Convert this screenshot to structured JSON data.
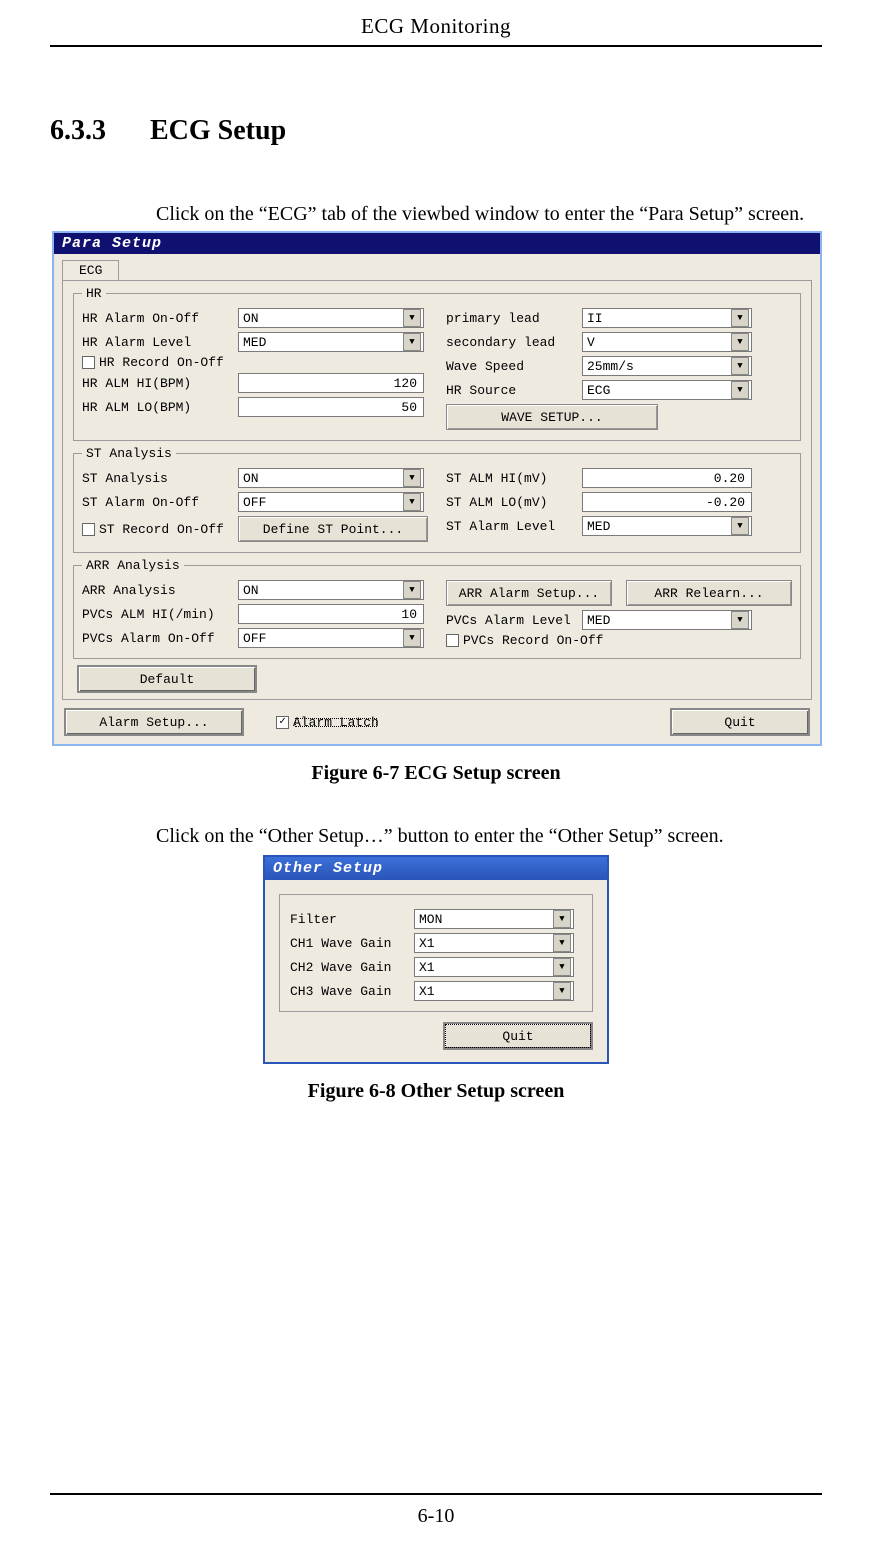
{
  "header": "ECG Monitoring",
  "section_number": "6.3.3",
  "section_title": "ECG Setup",
  "para1": "Click on the “ECG” tab of the viewbed window to enter the “Para Setup” screen.",
  "fig1_caption": "Figure 6-7 ECG Setup screen",
  "para2_pre": "Click on the “Other Setup",
  "para2_ell": "…",
  "para2_post": "” button to enter the “Other Setup” screen.",
  "fig2_caption": "Figure 6-8 Other Setup screen",
  "page_number": "6-10",
  "para_setup": {
    "title": "Para Setup",
    "tab": "ECG",
    "hr": {
      "legend": "HR",
      "alarm_onoff_lbl": "HR Alarm On-Off",
      "alarm_onoff_val": "ON",
      "alarm_level_lbl": "HR Alarm Level",
      "alarm_level_val": "MED",
      "record_onoff_lbl": "HR Record On-Off",
      "record_onoff_checked": false,
      "alm_hi_lbl": "HR ALM HI(BPM)",
      "alm_hi_val": "120",
      "alm_lo_lbl": "HR ALM LO(BPM)",
      "alm_lo_val": "50",
      "primary_lead_lbl": "primary lead",
      "primary_lead_val": "II",
      "secondary_lead_lbl": "secondary lead",
      "secondary_lead_val": "V",
      "wave_speed_lbl": "Wave Speed",
      "wave_speed_val": "25mm/s",
      "hr_source_lbl": "HR Source",
      "hr_source_val": "ECG",
      "wave_setup_btn": "WAVE SETUP..."
    },
    "st": {
      "legend": "ST Analysis",
      "analysis_lbl": "ST Analysis",
      "analysis_val": "ON",
      "alarm_onoff_lbl": "ST Alarm On-Off",
      "alarm_onoff_val": "OFF",
      "record_onoff_lbl": "ST Record On-Off",
      "record_onoff_checked": false,
      "define_btn": "Define ST Point...",
      "alm_hi_lbl": "ST ALM HI(mV)",
      "alm_hi_val": "0.20",
      "alm_lo_lbl": "ST ALM LO(mV)",
      "alm_lo_val": "-0.20",
      "alarm_level_lbl": "ST Alarm Level",
      "alarm_level_val": "MED"
    },
    "arr": {
      "legend": "ARR Analysis",
      "analysis_lbl": "ARR Analysis",
      "analysis_val": "ON",
      "alarm_setup_btn": "ARR Alarm Setup...",
      "relearn_btn": "ARR Relearn...",
      "pvcs_hi_lbl": "PVCs ALM HI(/min)",
      "pvcs_hi_val": "10",
      "pvcs_level_lbl": "PVCs Alarm Level",
      "pvcs_level_val": "MED",
      "pvcs_onoff_lbl": "PVCs Alarm On-Off",
      "pvcs_onoff_val": "OFF",
      "pvcs_record_lbl": "PVCs Record On-Off",
      "pvcs_record_checked": false
    },
    "default_btn": "Default",
    "alarm_setup_btn": "Alarm Setup...",
    "alarm_latch_lbl": "Alarm Latch",
    "alarm_latch_checked": true,
    "quit_btn": "Quit"
  },
  "other_setup": {
    "title": "Other Setup",
    "filter_lbl": "Filter",
    "filter_val": "MON",
    "ch1_lbl": "CH1 Wave Gain",
    "ch1_val": "X1",
    "ch2_lbl": "CH2 Wave Gain",
    "ch2_val": "X1",
    "ch3_lbl": "CH3 Wave Gain",
    "ch3_val": "X1",
    "quit_btn": "Quit"
  }
}
